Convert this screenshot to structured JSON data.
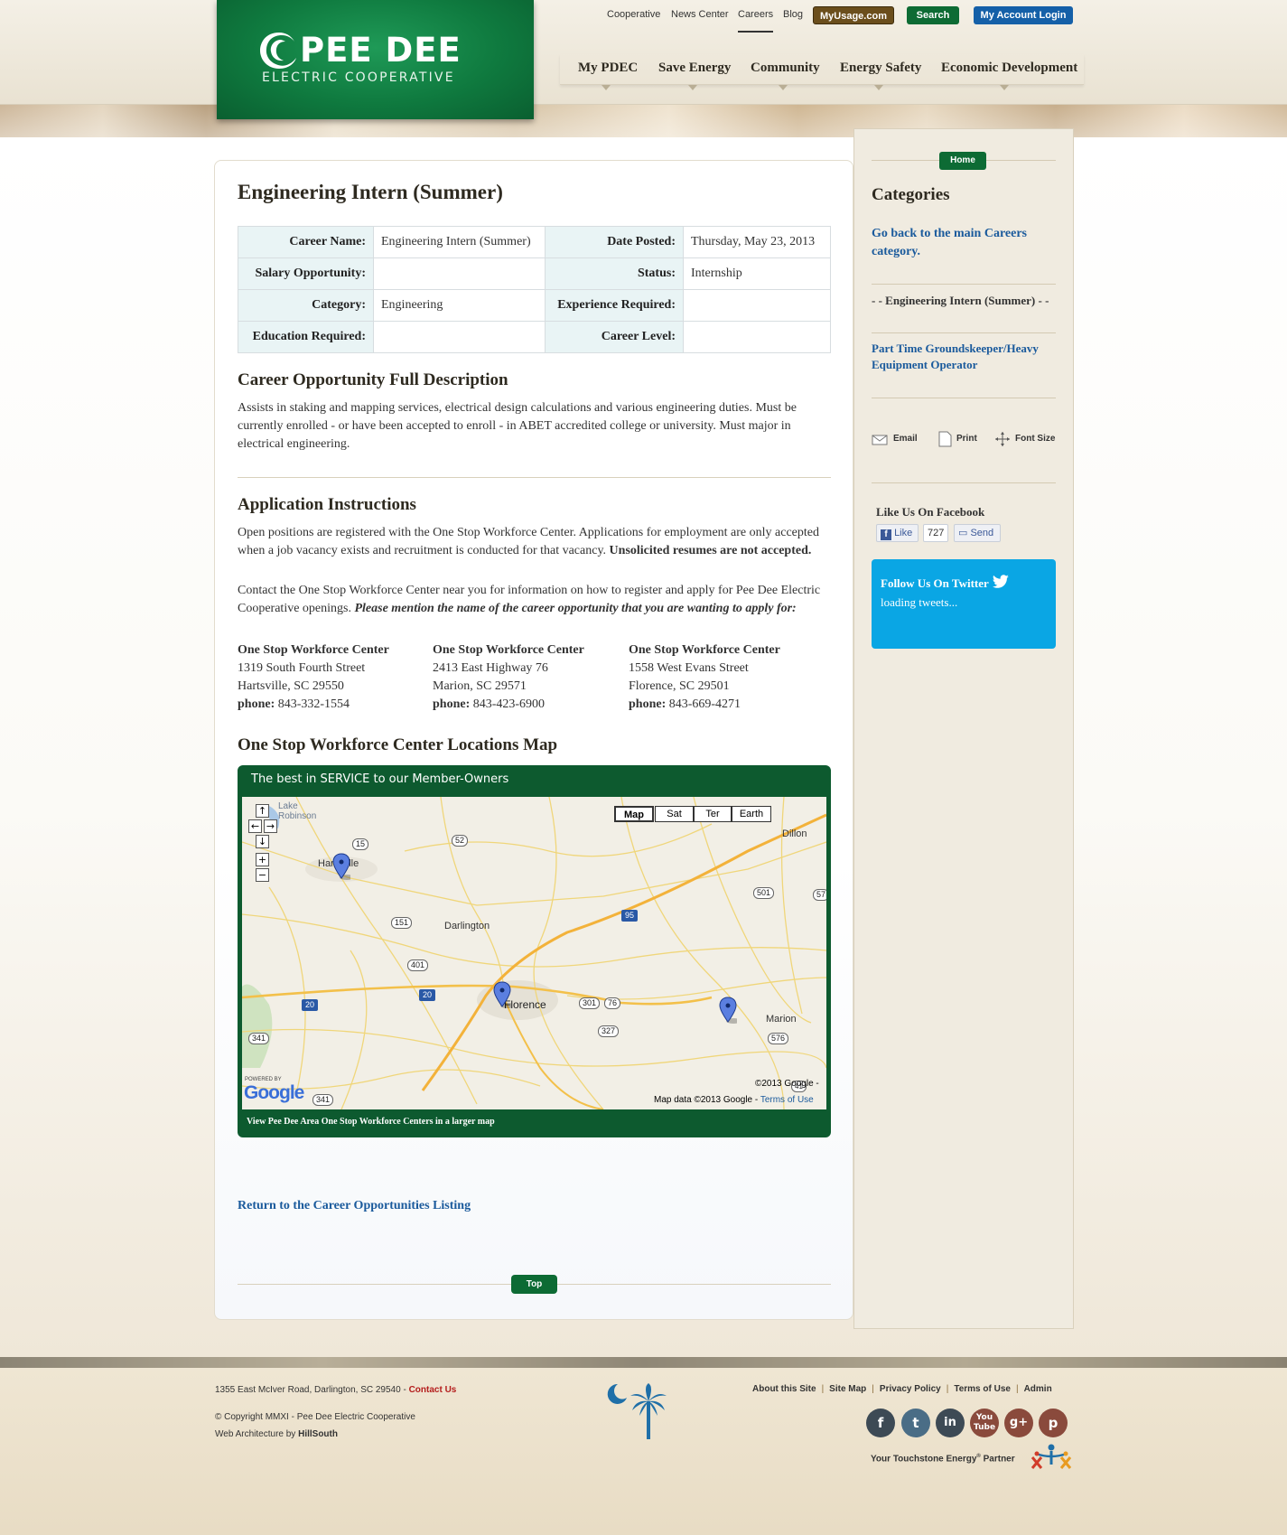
{
  "utility": {
    "links": [
      "Cooperative",
      "News Center",
      "Careers",
      "Blog"
    ],
    "myusage": "MyUsage.com",
    "search": "Search",
    "account": "My Account Login"
  },
  "logo": {
    "name": "PEE DEE",
    "sub": "ELECTRIC COOPERATIVE"
  },
  "nav": [
    "My PDEC",
    "Save Energy",
    "Community",
    "Energy Safety",
    "Economic Development"
  ],
  "page": {
    "title": "Engineering Intern (Summer)",
    "info": {
      "career_name_label": "Career Name:",
      "career_name": "Engineering Intern (Summer)",
      "date_label": "Date Posted:",
      "date": "Thursday, May 23, 2013",
      "salary_label": "Salary Opportunity:",
      "salary": "",
      "status_label": "Status:",
      "status": "Internship",
      "category_label": "Category:",
      "category": "Engineering",
      "experience_label": "Experience Required:",
      "experience": "",
      "education_label": "Education Required:",
      "education": "",
      "level_label": "Career Level:",
      "level": ""
    },
    "desc_title": "Career Opportunity Full Description",
    "desc": "Assists in staking and mapping services, electrical design calculations and various engineering duties.  Must be currently enrolled - or have been accepted to enroll - in ABET accredited college or university.  Must major in electrical engineering.",
    "app_title": "Application Instructions",
    "app_p1": "Open positions are registered with the One Stop Workforce Center. Applications for employment are only accepted when a job vacancy exists and recruitment is conducted for that vacancy. ",
    "app_p1_bold": "Unsolicited resumes are not accepted.",
    "app_p2": "Contact the One Stop Workforce Center near you for information on how to register and apply for Pee Dee Electric Cooperative openings. ",
    "app_p2_em": "Please mention the name of the career opportunity that you are wanting to apply for:",
    "offices": [
      {
        "name": "One Stop Workforce Center",
        "street": "1319 South Fourth Street",
        "city": "Hartsville, SC 29550",
        "phone_label": "phone:",
        "phone": "843-332-1554"
      },
      {
        "name": "One Stop Workforce Center",
        "street": "2413 East Highway 76",
        "city": "Marion, SC 29571",
        "phone_label": "phone:",
        "phone": "843-423-6900"
      },
      {
        "name": "One Stop Workforce Center",
        "street": "1558 West Evans Street",
        "city": "Florence, SC 29501",
        "phone_label": "phone:",
        "phone": "843-669-4271"
      }
    ],
    "map_title": "One Stop Workforce Center Locations Map",
    "map": {
      "header": "The best in SERVICE to our Member-Owners",
      "types": [
        "Map",
        "Sat",
        "Ter",
        "Earth"
      ],
      "selected_type": "Map",
      "places": [
        "Lake Robinson",
        "Hartsville",
        "Darlington",
        "Florence",
        "Marion",
        "Dillon"
      ],
      "routes": [
        "15",
        "52",
        "501",
        "57",
        "95",
        "151",
        "401",
        "20",
        "20",
        "301",
        "76",
        "327",
        "576",
        "341",
        "341",
        "41"
      ],
      "powered": "POWERED BY",
      "google": "Google",
      "copyright": "©2013 Google -",
      "mapdata": "Map data ©2013 Google - ",
      "terms": "Terms of Use",
      "footer_link": "View Pee Dee Area One Stop Workforce Centers in a larger map"
    },
    "return_link": "Return to the Career Opportunities Listing",
    "top": "Top"
  },
  "sidebar": {
    "home": "Home",
    "title": "Categories",
    "back": "Go back to the main Careers category.",
    "current": "- - Engineering Intern (Summer) - -",
    "other": "Part Time Groundskeeper/Heavy Equipment Operator",
    "email": "Email",
    "print": "Print",
    "font": "Font Size",
    "fb_title": "Like Us On Facebook",
    "fb_like": "Like",
    "fb_count": "727",
    "fb_send": "Send",
    "tw_title": "Follow Us On Twitter",
    "tw_loading": "loading tweets..."
  },
  "footer": {
    "address": "1355 East McIver Road, Darlington, SC 29540 - ",
    "contact": "Contact Us",
    "copyright": "© Copyright MMXI - Pee Dee Electric Cooperative",
    "web_arch": "Web Architecture by ",
    "hillsouth": "HillSouth",
    "links": [
      "About this Site",
      "Site Map",
      "Privacy Policy",
      "Terms of Use",
      "Admin"
    ],
    "social": [
      "facebook-icon",
      "twitter-icon",
      "linkedin-icon",
      "youtube-icon",
      "google-plus-icon",
      "pinterest-icon"
    ],
    "touchstone_prefix": "Your Touchstone Energy",
    "touchstone_reg": "®",
    "touchstone_suffix": " Partner"
  },
  "colors": {
    "brand_green": "#0d6b34",
    "link_blue": "#1a5a9c",
    "twitter": "#0aa6e4",
    "myusage": "#6b4e1c",
    "account": "#1560a8"
  }
}
